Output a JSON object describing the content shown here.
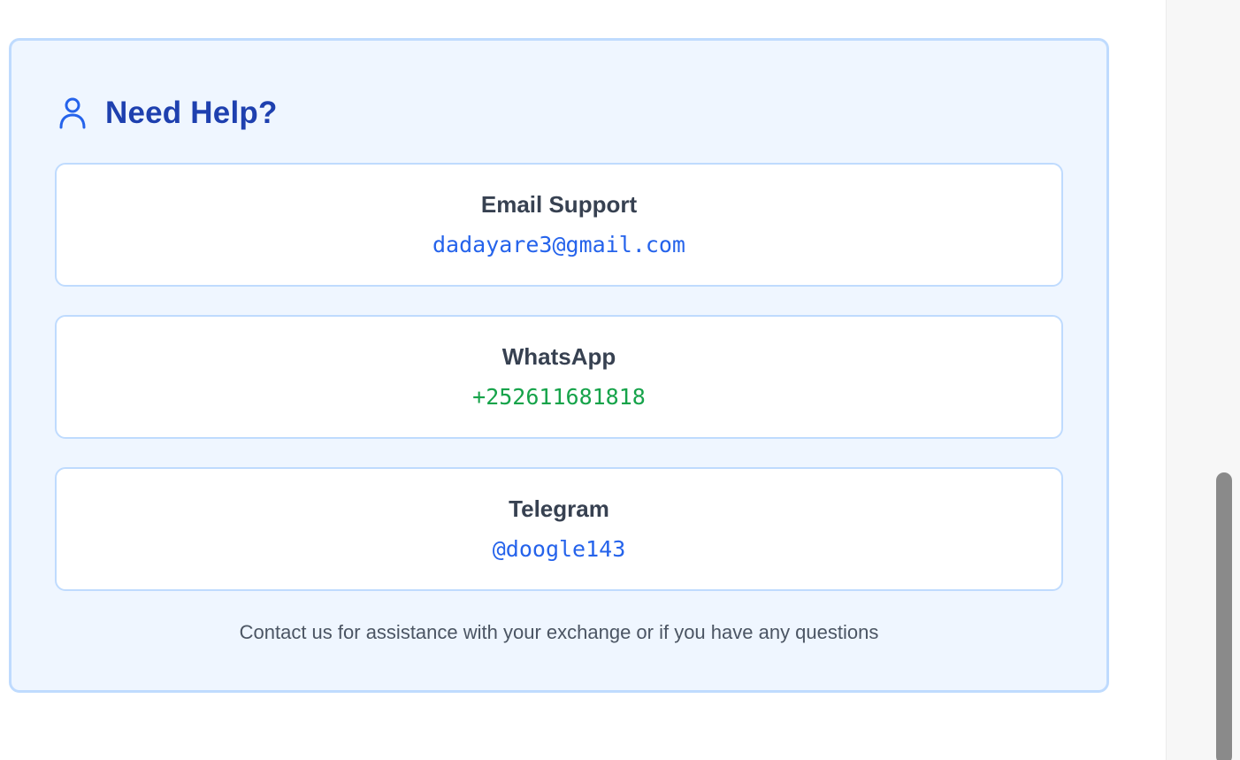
{
  "help": {
    "title": "Need Help?",
    "icon": "user-icon",
    "accent_color": "#2563eb",
    "contacts": [
      {
        "label": "Email Support",
        "value": "dadayare3@gmail.com",
        "color": "#2563eb"
      },
      {
        "label": "WhatsApp",
        "value": "+252611681818",
        "color": "#16a34a"
      },
      {
        "label": "Telegram",
        "value": "@doogle143",
        "color": "#2563eb"
      }
    ],
    "footer": "Contact us for assistance with your exchange or if you have any questions"
  }
}
